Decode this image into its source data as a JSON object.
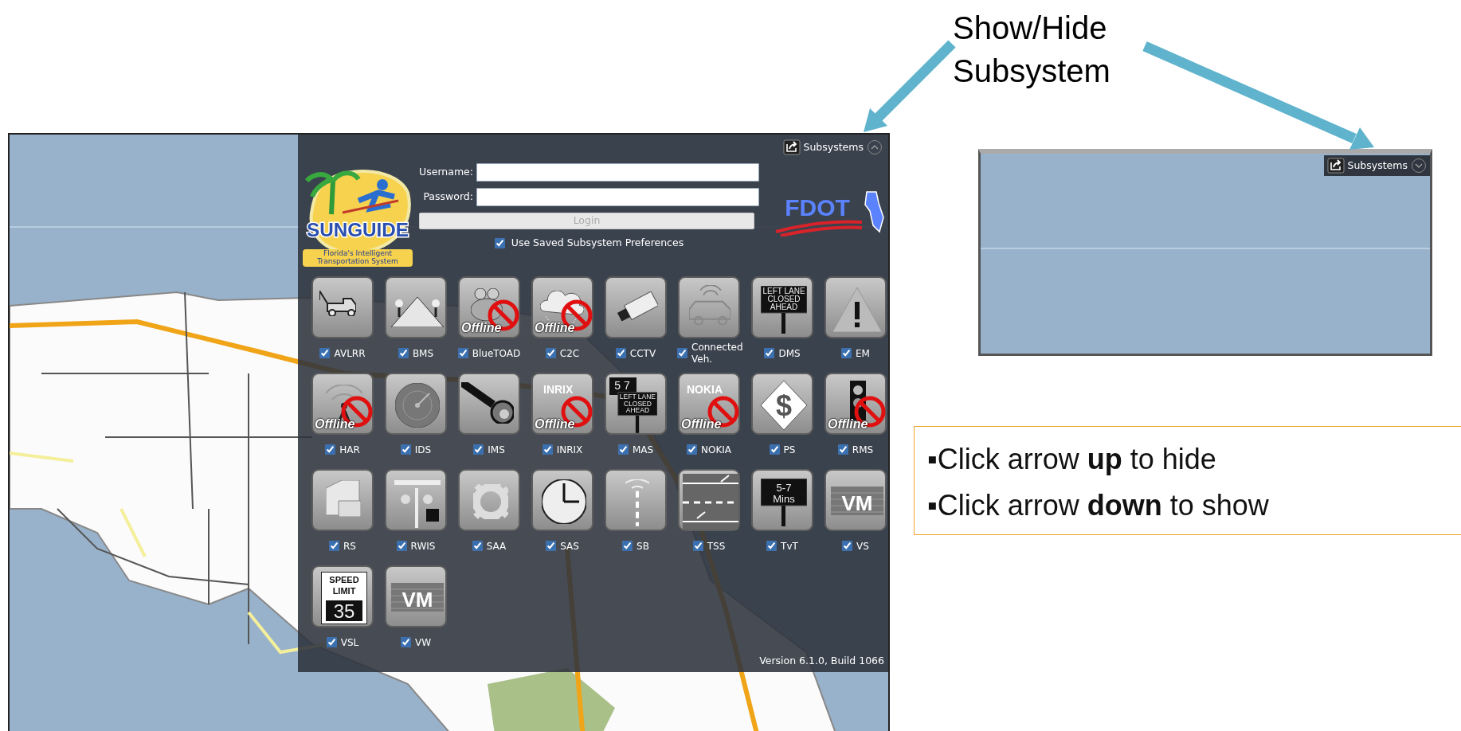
{
  "annotation": {
    "label": "Show/Hide Subsystem"
  },
  "main_screenshot": {
    "subsystems_button": {
      "label": "Subsystems",
      "expanded": true
    },
    "logo": {
      "text": "SUNGUIDE",
      "tagline": "Florida's Intelligent Transportation System"
    },
    "agency_logo": {
      "text": "FDOT"
    },
    "login_form": {
      "username_label": "Username:",
      "password_label": "Password:",
      "login_button": {
        "label": "Login",
        "disabled": true
      },
      "saved_preferences": {
        "label": "Use Saved Subsystem Preferences",
        "checked": true
      }
    },
    "subsystems": [
      {
        "label": "AVLRR",
        "checked": true,
        "kind": "truck"
      },
      {
        "label": "BMS",
        "checked": true,
        "kind": "ramp"
      },
      {
        "label": "BlueTOAD",
        "checked": true,
        "kind": "frog",
        "offline_text": "Offline"
      },
      {
        "label": "C2C",
        "checked": true,
        "kind": "cloud",
        "offline_text": "Offline"
      },
      {
        "label": "CCTV",
        "checked": true,
        "kind": "camera"
      },
      {
        "label": "Connected Veh.",
        "checked": true,
        "kind": "car"
      },
      {
        "label": "DMS",
        "checked": true,
        "kind": "sign",
        "sign": [
          "LEFT LANE",
          "CLOSED",
          "AHEAD"
        ]
      },
      {
        "label": "EM",
        "checked": true,
        "kind": "warning"
      },
      {
        "label": "HAR",
        "checked": true,
        "kind": "broadcast",
        "offline_text": "Offline"
      },
      {
        "label": "IDS",
        "checked": true,
        "kind": "radar"
      },
      {
        "label": "IMS",
        "checked": true,
        "kind": "wrench"
      },
      {
        "label": "INRIX",
        "checked": true,
        "kind": "wordmark",
        "sign": [
          "INRIX"
        ],
        "offline_text": "Offline"
      },
      {
        "label": "MAS",
        "checked": true,
        "kind": "sign",
        "back_sign": "5 7",
        "sign": [
          "LEFT LANE",
          "CLOSED",
          "AHEAD"
        ]
      },
      {
        "label": "NOKIA",
        "checked": true,
        "kind": "wordmark",
        "sign": [
          "NOKIA"
        ],
        "offline_text": "Offline"
      },
      {
        "label": "PS",
        "checked": true,
        "kind": "dollar",
        "sign": [
          "$"
        ]
      },
      {
        "label": "RMS",
        "checked": true,
        "kind": "signal",
        "offline_text": "Offline"
      },
      {
        "label": "RS",
        "checked": true,
        "kind": "cabinet"
      },
      {
        "label": "RWIS",
        "checked": true,
        "kind": "weather"
      },
      {
        "label": "SAA",
        "checked": true,
        "kind": "gear"
      },
      {
        "label": "SAS",
        "checked": true,
        "kind": "clock"
      },
      {
        "label": "SB",
        "checked": true,
        "kind": "pole"
      },
      {
        "label": "TSS",
        "checked": true,
        "kind": "road"
      },
      {
        "label": "TvT",
        "checked": true,
        "kind": "sign",
        "sign": [
          "5-7",
          "Mins"
        ]
      },
      {
        "label": "VS",
        "checked": true,
        "kind": "vm",
        "sign": [
          "VM"
        ]
      },
      {
        "label": "VSL",
        "checked": true,
        "kind": "speed",
        "sign": [
          "SPEED",
          "LIMIT",
          "35"
        ]
      },
      {
        "label": "VW",
        "checked": true,
        "kind": "vm",
        "sign": [
          "VM"
        ]
      }
    ],
    "version": "Version 6.1.0, Build 1066"
  },
  "collapsed_screenshot": {
    "subsystems_button": {
      "label": "Subsystems",
      "expanded": false
    }
  },
  "callout": {
    "items": [
      "▪Click arrow **up** to hide",
      "▪Click arrow **down** to show"
    ]
  }
}
